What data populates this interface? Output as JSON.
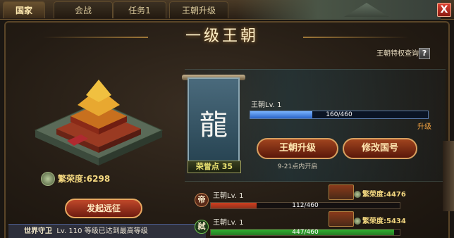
{
  "tabs": [
    {
      "label": "国家",
      "active": true
    },
    {
      "label": "会战",
      "active": false
    },
    {
      "label": "任务1",
      "active": false
    },
    {
      "label": "王朝升级",
      "active": false
    }
  ],
  "close_label": "X",
  "title": "一级王朝",
  "privilege_link": "王朝特权查询",
  "help_label": "?",
  "honor_total": "繁荣度:6298",
  "expedition_button": "发起远征",
  "world_guard": {
    "name": "世界守卫",
    "level": "Lv. 110",
    "note": "等级已达到最高等级"
  },
  "banner": {
    "glyph": "龍",
    "honor_points": "荣誉点 35"
  },
  "dynasty": {
    "level_label": "王朝Lv. 1",
    "progress_text": "160/460",
    "progress": 0.348,
    "upgrade_label": "升级",
    "upgrade_button": "王朝升级",
    "rename_button": "修改国号",
    "hint": "9-21点内开启"
  },
  "rows": [
    {
      "icon_char": "帝",
      "name": "王朝Lv. 1",
      "progress_text": "112/460",
      "progress": 0.243,
      "honor": "繁荣度:4476",
      "color": "#d04020",
      "icon_bg": "#5a2a18",
      "icon_border": "#c08050"
    },
    {
      "icon_char": "弑",
      "name": "王朝Lv. 1",
      "progress_text": "447/460",
      "progress": 0.972,
      "honor": "繁荣度:5434",
      "color": "#30b030",
      "icon_bg": "#1e3a1a",
      "icon_border": "#70c050"
    }
  ]
}
